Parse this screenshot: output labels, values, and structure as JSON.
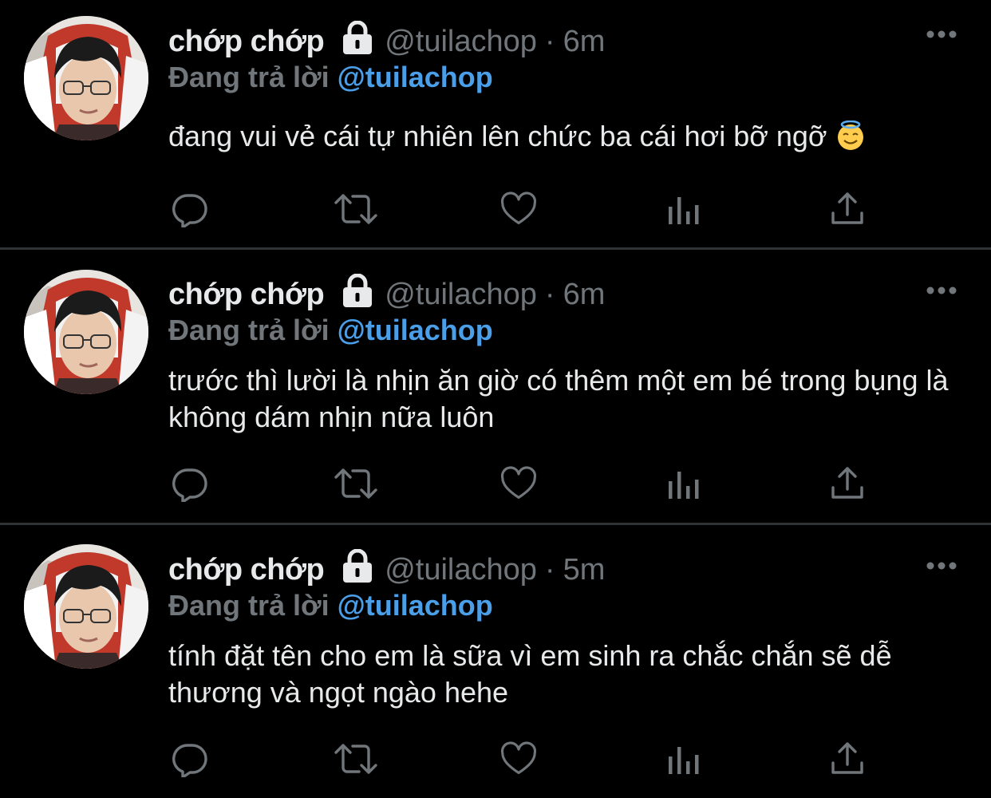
{
  "tweets": [
    {
      "display_name": "chớp chớp",
      "handle": "@tuilachop",
      "separator": "·",
      "time": "6m",
      "reply_prefix": "Đang trả lời",
      "reply_mention": "@tuilachop",
      "text": "đang vui vẻ cái tự nhiên lên chức ba cái hơi bỡ ngỡ",
      "emoji": "smiling-face-with-halo"
    },
    {
      "display_name": "chớp chớp",
      "handle": "@tuilachop",
      "separator": "·",
      "time": "6m",
      "reply_prefix": "Đang trả lời",
      "reply_mention": "@tuilachop",
      "text": "trước thì lười là nhịn ăn giờ có thêm một em bé trong bụng là không dám nhịn nữa luôn"
    },
    {
      "display_name": "chớp chớp",
      "handle": "@tuilachop",
      "separator": "·",
      "time": "5m",
      "reply_prefix": "Đang trả lời",
      "reply_mention": "@tuilachop",
      "text": "tính đặt tên cho em là sữa vì em sinh ra chắc chắn sẽ dễ thương và ngọt ngào hehe"
    }
  ],
  "icons": {
    "lock": "lock-icon",
    "more": "more-icon",
    "reply": "reply-icon",
    "retweet": "retweet-icon",
    "like": "like-icon",
    "views": "views-icon",
    "share": "share-icon"
  },
  "colors": {
    "background": "#000000",
    "text": "#e7e9ea",
    "muted": "#71767b",
    "mention": "#4a9fe8",
    "divider": "#2f3336"
  }
}
